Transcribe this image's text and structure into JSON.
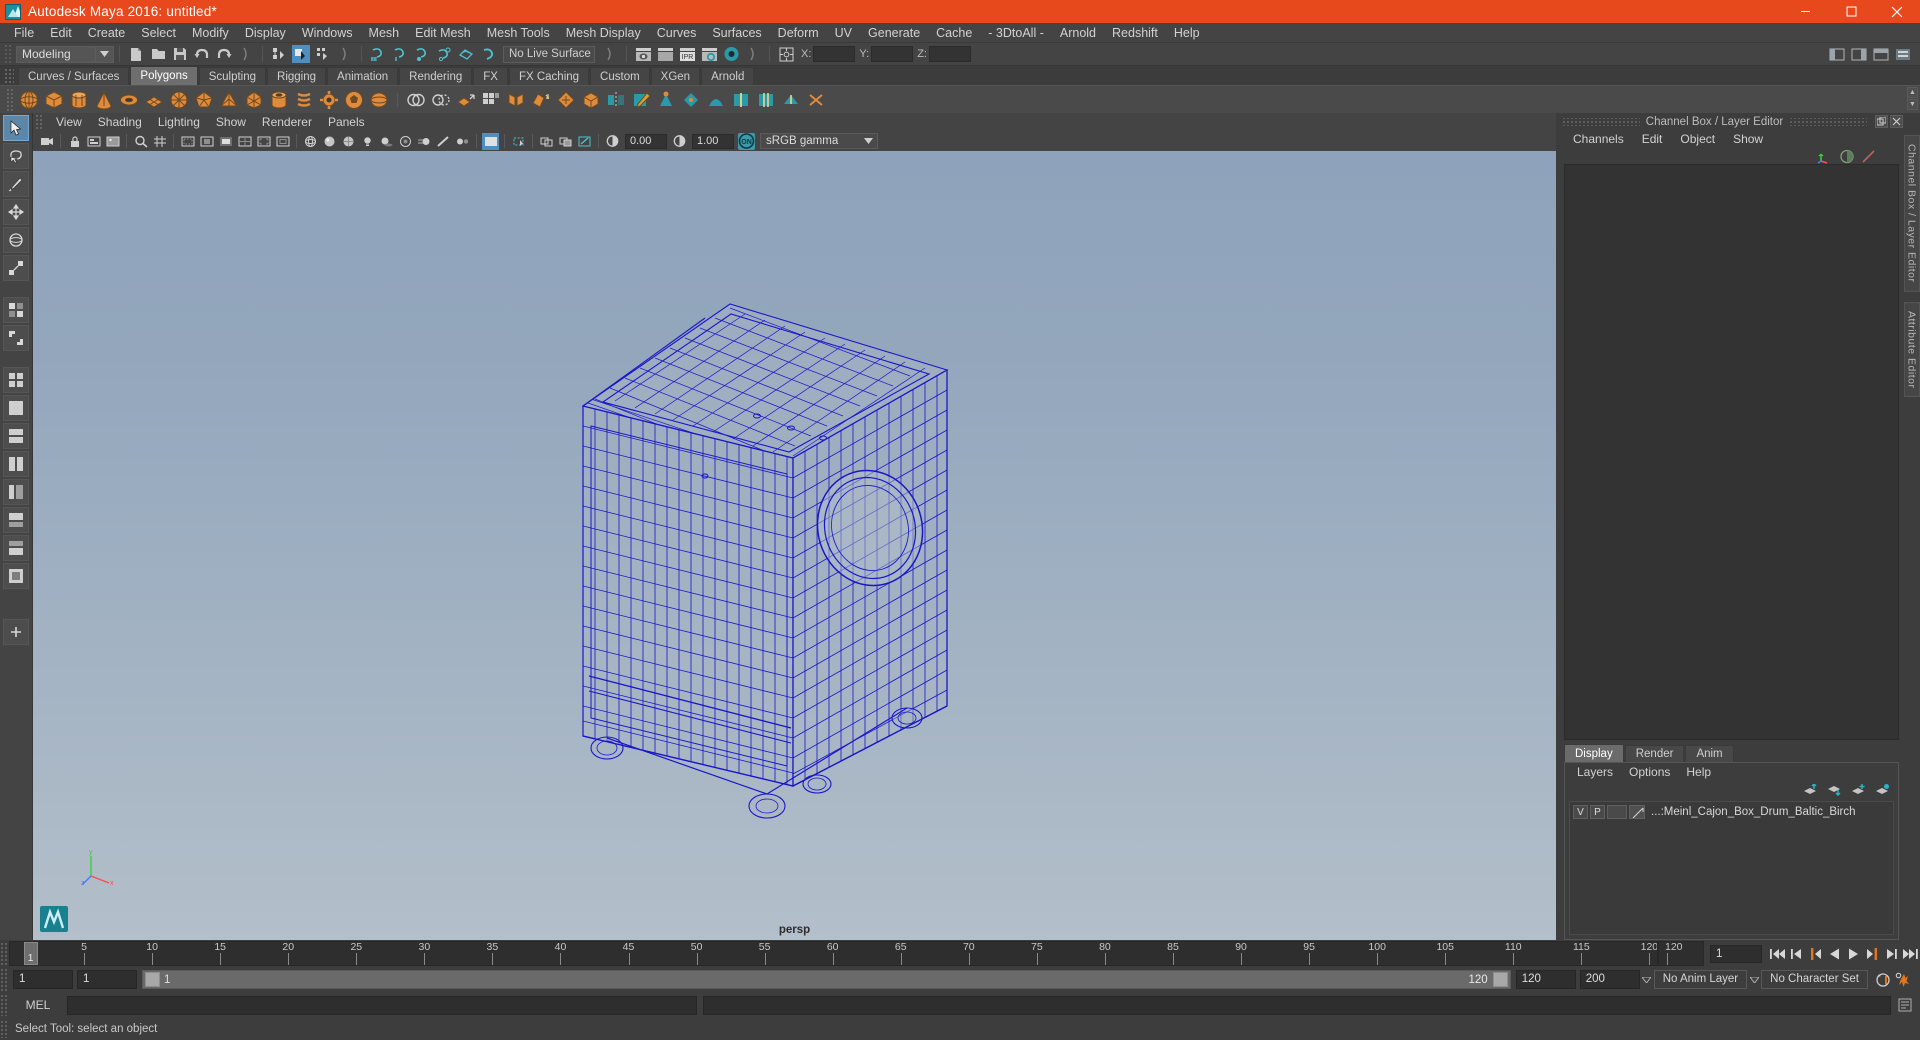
{
  "window": {
    "title": "Autodesk Maya 2016: untitled*",
    "app_icon": "maya-logo-icon",
    "controls": {
      "minimize": "minimize-icon",
      "maximize": "maximize-icon",
      "close": "close-icon"
    }
  },
  "menubar": {
    "items": [
      "File",
      "Edit",
      "Create",
      "Select",
      "Modify",
      "Display",
      "Windows",
      "Mesh",
      "Edit Mesh",
      "Mesh Tools",
      "Mesh Display",
      "Curves",
      "Surfaces",
      "Deform",
      "UV",
      "Generate",
      "Cache",
      "- 3DtoAll -",
      "Arnold",
      "Redshift",
      "Help"
    ]
  },
  "statusbar": {
    "menu_set": "Modeling",
    "live_surface": "No Live Surface",
    "coord_x_label": "X:",
    "coord_y_label": "Y:",
    "coord_z_label": "Z:",
    "coord_x_value": "",
    "coord_y_value": "",
    "coord_z_value": "",
    "icons": [
      "new-scene-icon",
      "open-scene-icon",
      "save-scene-icon",
      "undo-icon",
      "redo-icon",
      "select-by-hierarchy-icon",
      "select-by-object-icon",
      "select-by-component-icon",
      "snap-to-grid-icon",
      "snap-to-curve-icon",
      "snap-to-point-icon",
      "snap-to-projected-center-icon",
      "snap-to-view-plane-icon",
      "make-live-icon",
      "render-view-icon",
      "render-current-frame-icon",
      "ipr-render-icon",
      "render-settings-icon",
      "hypershade-icon",
      "toggle-selection-mask-icon"
    ],
    "right_icons": [
      "show-hide-attribute-editor-icon",
      "show-hide-tool-settings-icon",
      "show-hide-channel-box-icon",
      "workspace-icon"
    ]
  },
  "shelf": {
    "tabs": [
      "Curves / Surfaces",
      "Polygons",
      "Sculpting",
      "Rigging",
      "Animation",
      "Rendering",
      "FX",
      "FX Caching",
      "Custom",
      "XGen",
      "Arnold"
    ],
    "active_tab": "Polygons",
    "icons": [
      "poly-sphere-icon",
      "poly-cube-icon",
      "poly-cylinder-icon",
      "poly-cone-icon",
      "poly-torus-icon",
      "poly-plane-icon",
      "poly-disc-icon",
      "poly-platonic-icon",
      "poly-pyramid-icon",
      "poly-prism-icon",
      "poly-pipe-icon",
      "poly-helix-icon",
      "poly-gear-icon",
      "poly-soccer-ball-icon",
      "poly-super-ellipse-icon",
      "combine-icon",
      "separate-icon",
      "extrude-icon",
      "bevel-icon",
      "bridge-icon",
      "append-polygon-icon",
      "smooth-icon",
      "booleans-icon",
      "mirror-icon",
      "multi-cut-icon",
      "target-weld-icon",
      "quad-draw-icon",
      "sculpt-icon",
      "insert-edge-loop-icon",
      "offset-edge-loop-icon",
      "crease-tool-icon",
      "connect-icon"
    ]
  },
  "toolbox": {
    "tools": [
      "select-tool",
      "lasso-select-tool",
      "paint-select-tool",
      "move-tool",
      "rotate-tool",
      "scale-tool",
      "last-tool-used",
      "show-manipulator-tool",
      "four-view-layout-icon",
      "single-perspective-layout-icon",
      "two-panes-stacked-layout-icon",
      "two-panes-side-layout-icon",
      "outliner-persp-layout-icon",
      "persp-graph-layout-icon",
      "hypershade-persp-layout-icon",
      "persp-render-layout-icon",
      "add-new-bookmark-icon"
    ],
    "selected": "select-tool"
  },
  "viewport": {
    "menus": [
      "View",
      "Shading",
      "Lighting",
      "Show",
      "Renderer",
      "Panels"
    ],
    "toolbar": {
      "exposure_value": "0.00",
      "gamma_value": "1.00",
      "color_management": "sRGB gamma",
      "gate_toggle_label": "ON",
      "icons": [
        "select-camera-icon",
        "lock-camera-icon",
        "camera-attributes-icon",
        "image-plane-icon",
        "two-d-pan-zoom-icon",
        "grid-icon",
        "film-gate-icon",
        "resolution-gate-icon",
        "gate-mask-icon",
        "field-chart-icon",
        "safe-action-icon",
        "safe-title-icon",
        "wireframe-icon",
        "smooth-shade-all-icon",
        "shaded-and-textured-icon",
        "use-all-lights-icon",
        "shadows-icon",
        "screen-space-ambient-occlusion-icon",
        "motion-blur-icon",
        "multisample-anti-aliasing-icon",
        "depth-of-field-icon",
        "isolate-select-icon",
        "xray-icon",
        "xray-joints-icon",
        "exposure-icon",
        "contrast-icon",
        "color-management-toggle-icon"
      ]
    },
    "camera_label": "persp",
    "axis_labels": {
      "y": "y",
      "x": "x",
      "z": "z"
    },
    "model_name": "cajon-box-drum-wireframe",
    "wireframe_color": "#1a16c8",
    "background_top": "#8ea3bb",
    "background_bottom": "#b3bfca"
  },
  "right_panel": {
    "title": "Channel Box / Layer Editor",
    "window_buttons": [
      "undock-icon",
      "close-icon"
    ],
    "channelbox": {
      "menus": [
        "Channels",
        "Edit",
        "Object",
        "Show"
      ],
      "icons": [
        "channel-box-icon",
        "attribute-editor-icon",
        "modeling-toolkit-icon"
      ],
      "rows": []
    },
    "layer_editor": {
      "tabs": [
        "Display",
        "Render",
        "Anim"
      ],
      "active_tab": "Display",
      "menus": [
        "Layers",
        "Options",
        "Help"
      ],
      "buttons": [
        "move-layer-up-icon",
        "move-layer-down-icon",
        "create-new-layer-icon",
        "create-layer-from-selected-icon"
      ],
      "layers": [
        {
          "visibility": "V",
          "playback": "P",
          "type": "",
          "color_swatch": "layer-color-icon",
          "name": "...:Meinl_Cajon_Box_Drum_Baltic_Birch"
        }
      ]
    },
    "side_tabs": [
      "Channel Box / Layer Editor",
      "Attribute Editor"
    ]
  },
  "timeline": {
    "ticks": [
      5,
      10,
      15,
      20,
      25,
      30,
      35,
      40,
      45,
      50,
      55,
      60,
      65,
      70,
      75,
      80,
      85,
      90,
      95,
      100,
      105,
      110,
      115,
      120
    ],
    "start_frame": "1",
    "end_frame": "120",
    "current_frame": "1",
    "current_frame_field": "1",
    "playback_buttons": [
      "go-to-start-icon",
      "step-back-frame-icon",
      "step-back-key-icon",
      "play-backwards-icon",
      "play-forwards-icon",
      "step-forward-key-icon",
      "step-forward-frame-icon",
      "go-to-end-icon"
    ]
  },
  "range_slider": {
    "anim_start": "1",
    "playback_start": "1",
    "range_label_left": "1",
    "range_label_right": "120",
    "playback_end": "120",
    "anim_end": "200",
    "anim_layer": "No Anim Layer",
    "character_set": "No Character Set",
    "icons": [
      "auto-keyframe-icon",
      "animation-preferences-icon"
    ]
  },
  "command_line": {
    "language_label": "MEL",
    "input_value": "",
    "output_value": ""
  },
  "help_line": {
    "text": "Select Tool: select an object"
  },
  "colors": {
    "title_bar": "#e8491c",
    "panel_bg": "#444444",
    "app_bg": "#3d3d3d",
    "accent_blue": "#4f8fc0",
    "accent_teal": "#3d9aa8",
    "shelf_orange": "#e08a3c",
    "wire_blue": "#1a16c8",
    "highlight_orange": "#e2761b"
  }
}
